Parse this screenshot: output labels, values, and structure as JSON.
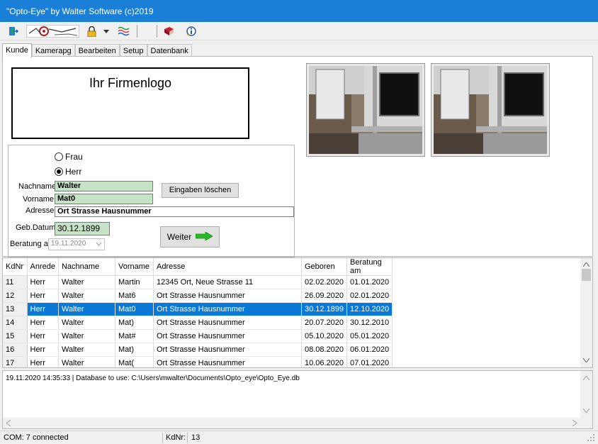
{
  "window": {
    "title": "\"Opto-Eye\" by Walter Software (c)2019"
  },
  "toolbar": {
    "icons": [
      "exit-icon",
      "logo-strip-icon",
      "lock-icon",
      "dropdown-arrow-icon",
      "wave-icon",
      "book-icon",
      "info-icon"
    ]
  },
  "tabs": [
    "Kunde",
    "Kamerapg",
    "Bearbeiten",
    "Setup",
    "Datenbank"
  ],
  "logo_placeholder": "Ihr Firmenlogo",
  "form": {
    "radio_frau": "Frau",
    "radio_herr": "Herr",
    "selected_gender": "Herr",
    "nachname_label": "Nachname",
    "nachname_value": "Walter",
    "vorname_label": "Vorname",
    "vorname_value": "Mat0",
    "adresse_label": "Adresse",
    "adresse_value": "Ort Strasse Hausnummer",
    "gebdatum_label": "Geb.Datum",
    "gebdatum_value": "30.12.1899",
    "beratung_label": "Beratung am",
    "beratung_value": "19.11.2020",
    "clear_button": "Eingaben löschen",
    "next_button": "Weiter"
  },
  "table": {
    "headers": [
      "KdNr",
      "Anrede",
      "Nachname",
      "Vorname",
      "Adresse",
      "Geboren",
      "Beratung am"
    ],
    "selected_kdnr": "13",
    "rows": [
      [
        "11",
        "Herr",
        "Walter",
        "Martin",
        "12345 Ort, Neue Strasse 11",
        "02.02.2020",
        "01.01.2020"
      ],
      [
        "12",
        "Herr",
        "Walter",
        "Mat6",
        "Ort Strasse Hausnummer",
        "26.09.2020",
        "02.01.2020"
      ],
      [
        "13",
        "Herr",
        "Walter",
        "Mat0",
        "Ort Strasse Hausnummer",
        "30.12.1899",
        "12.10.2020"
      ],
      [
        "14",
        "Herr",
        "Walter",
        "Mat)",
        "Ort Strasse Hausnummer",
        "20.07.2020",
        "30.12.2010"
      ],
      [
        "15",
        "Herr",
        "Walter",
        "Mat#",
        "Ort Strasse Hausnummer",
        "05.10.2020",
        "05.01.2020"
      ],
      [
        "16",
        "Herr",
        "Walter",
        "Mat)",
        "Ort Strasse Hausnummer",
        "08.08.2020",
        "06.01.2020"
      ],
      [
        "17",
        "Herr",
        "Walter",
        "Mat(",
        "Ort Strasse Hausnummer",
        "10.06.2020",
        "07.01.2020"
      ]
    ]
  },
  "log": {
    "line": "19.11.2020 14:35:33 | Database to use: C:\\Users\\mwalter\\Documents\\Opto_eye\\Opto_Eye.db"
  },
  "status": {
    "com": "COM: 7 connected",
    "kdnr_label": "KdNr:",
    "kdnr_value": "13"
  },
  "colors": {
    "titlebar": "#1a7fd6",
    "selection": "#0a78d7",
    "field_green": "#c7e3c7"
  }
}
